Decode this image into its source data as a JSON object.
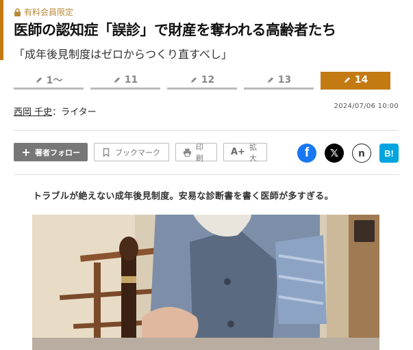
{
  "premium_label": "有料会員限定",
  "title": "医師の認知症「誤診」で財産を奪われる高齢者たち",
  "subtitle": "「成年後見制度はゼロからつくり直すべし」",
  "pagination": [
    {
      "label": "1〜",
      "active": false
    },
    {
      "label": "11",
      "active": false
    },
    {
      "label": "12",
      "active": false
    },
    {
      "label": "13",
      "active": false
    },
    {
      "label": "14",
      "active": true
    }
  ],
  "author": {
    "name": "西岡 千史",
    "role": "：ライター"
  },
  "date": "2024/07/06 10:00",
  "toolbar": {
    "follow": "著者フォロー",
    "bookmark": "ブックマーク",
    "print": "印刷",
    "zoom": "拡大"
  },
  "share_icons": [
    "facebook-icon",
    "x-icon",
    "note-icon",
    "hatena-bookmark-icon"
  ],
  "share_labels": {
    "facebook": "f",
    "x": "𝕏",
    "note": "n",
    "hatena": "B!"
  },
  "lead": "トラブルが絶えない成年後見制度。安易な診断書を書く医師が多すぎる。",
  "colors": {
    "accent": "#c47a12",
    "premium": "#b98a3a",
    "facebook": "#1877f2",
    "x": "#000000",
    "hatena": "#00a4de"
  }
}
